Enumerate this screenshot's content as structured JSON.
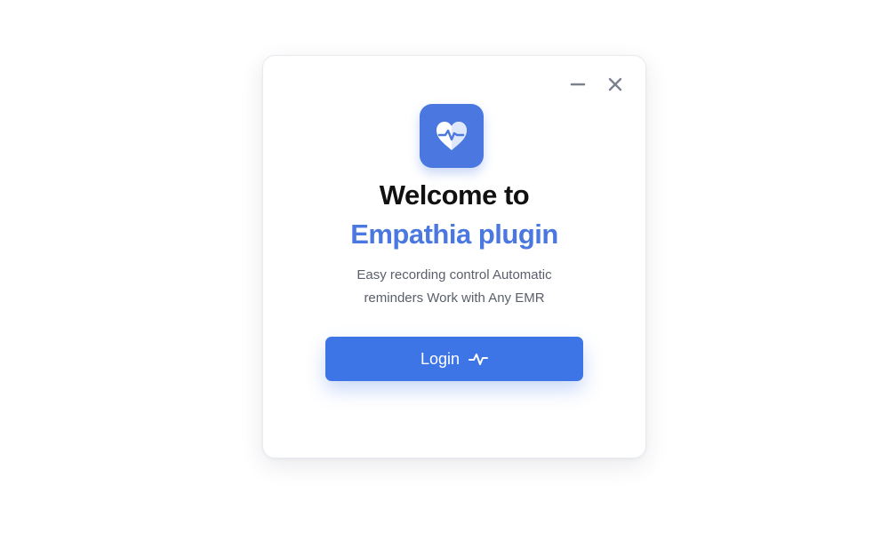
{
  "window": {
    "minimize_icon": "minus-icon",
    "close_icon": "close-icon"
  },
  "app": {
    "icon": "heart-pulse-icon",
    "accent_color": "#4a78e0",
    "button_color": "#3d74e6"
  },
  "welcome": {
    "line1": "Welcome to",
    "line2": "Empathia plugin"
  },
  "description": {
    "line1": "Easy recording control Automatic",
    "line2": "reminders Work with Any EMR"
  },
  "login": {
    "label": "Login",
    "icon": "pulse-icon"
  }
}
